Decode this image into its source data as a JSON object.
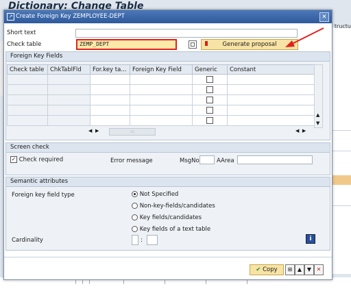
{
  "background": {
    "title": "Dictionary: Change Table",
    "right_edge_text": "tructu"
  },
  "dialog": {
    "title": "Create Foreign Key ZEMPLOYEE-DEPT",
    "short_text_label": "Short text",
    "short_text_value": "",
    "check_table_label": "Check table",
    "check_table_value": "ZEMP_DEPT",
    "generate_proposal_label": "Generate proposal"
  },
  "fk_fields": {
    "header": "Foreign Key Fields",
    "columns": [
      "Check table",
      "ChkTablFld",
      "For.key ta...",
      "Foreign Key Field",
      "Generic",
      "Constant"
    ],
    "rows": [
      {
        "generic": false
      },
      {
        "generic": false
      },
      {
        "generic": false
      },
      {
        "generic": false
      },
      {
        "generic": false
      }
    ],
    "hscroll_mid": ":::"
  },
  "screen_check": {
    "header": "Screen check",
    "check_required_label": "Check required",
    "check_required_checked": true,
    "error_message_label": "Error message",
    "msgno_label": "MsgNo",
    "msgno_value": "",
    "aarea_label": "AArea",
    "aarea_value": ""
  },
  "semantic": {
    "header": "Semantic attributes",
    "fk_field_type_label": "Foreign key field type",
    "options": [
      {
        "label": "Not Specified",
        "selected": true
      },
      {
        "label": "Non-key-fields/candidates",
        "selected": false
      },
      {
        "label": "Key fields/candidates",
        "selected": false
      },
      {
        "label": "Key fields of a text table",
        "selected": false
      }
    ],
    "cardinality_label": "Cardinality",
    "cardinality_left": "",
    "cardinality_sep": ":",
    "cardinality_right": ""
  },
  "footer": {
    "copy_label": "Copy"
  },
  "colors": {
    "highlight_border": "#e2211c",
    "accent_yellow": "#f7e3a5",
    "titlebar": "#2e5a9c"
  }
}
